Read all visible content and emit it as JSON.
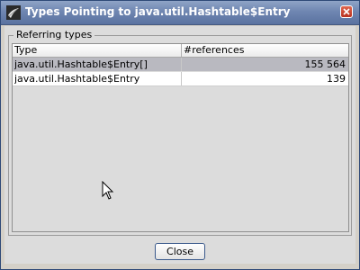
{
  "window": {
    "title": "Types Pointing to java.util.Hashtable$Entry",
    "close_icon": "close-icon"
  },
  "group": {
    "label": "Referring types"
  },
  "table": {
    "columns": [
      "Type",
      "#references"
    ],
    "rows": [
      {
        "type": "java.util.Hashtable$Entry[]",
        "references": "155 564",
        "selected": true
      },
      {
        "type": "java.util.Hashtable$Entry",
        "references": "139",
        "selected": false
      }
    ]
  },
  "buttons": {
    "close_label": "Close"
  },
  "colors": {
    "titlebar": "#6f86b1",
    "selected_row": "#b9b9c0",
    "dialog_bg": "#dcdcdc"
  }
}
